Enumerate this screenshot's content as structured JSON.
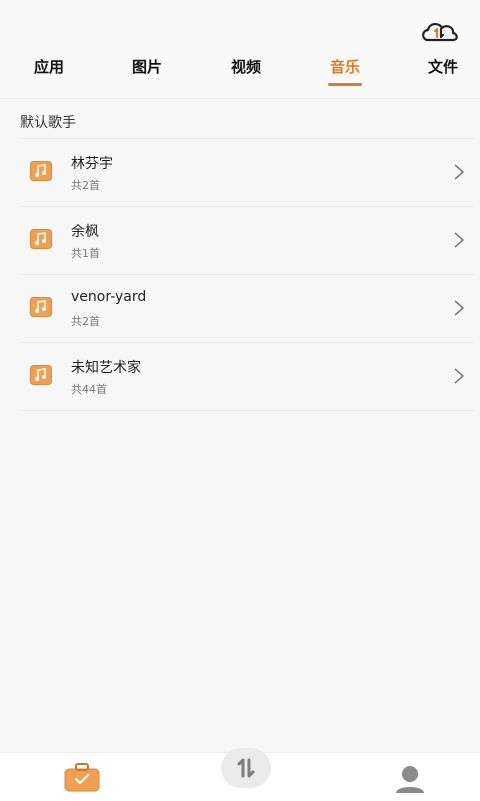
{
  "header": {
    "tabs": [
      {
        "label": "应用",
        "active": false
      },
      {
        "label": "图片",
        "active": false
      },
      {
        "label": "视频",
        "active": false
      },
      {
        "label": "音乐",
        "active": true
      },
      {
        "label": "文件",
        "active": false
      }
    ],
    "cloud_icon": "cloud-sync-icon"
  },
  "section": {
    "title": "默认歌手"
  },
  "artists": [
    {
      "name": "林芬宇",
      "count": "共2首"
    },
    {
      "name": "余枫",
      "count": "共1首"
    },
    {
      "name": "venor-yard",
      "count": "共2首"
    },
    {
      "name": "未知艺术家",
      "count": "共44首"
    }
  ],
  "bottom_nav": {
    "left_icon": "briefcase-check-icon",
    "center_icon": "transfer-arrows-icon",
    "right_icon": "user-icon"
  },
  "colors": {
    "accent": "#e07b23",
    "icon_orange": "#f0a052"
  }
}
